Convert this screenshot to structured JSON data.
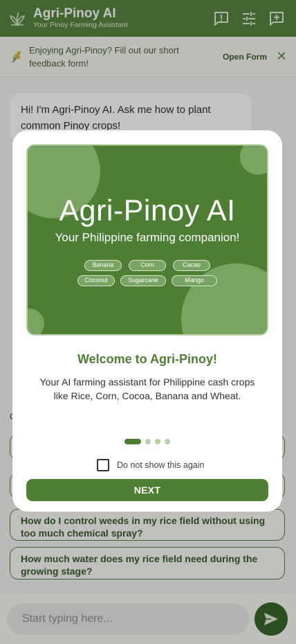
{
  "header": {
    "title": "Agri-Pinoy AI",
    "subtitle": "Your Pinoy Farming Assistant",
    "icons": [
      "feedback-icon",
      "tune-icon",
      "new-chat-icon"
    ]
  },
  "banner": {
    "text": "Enjoying Agri-Pinoy? Fill out our short feedback form!",
    "link": "Open Form",
    "close": "✕"
  },
  "chat": {
    "greeting": "Hi! I'm Agri-Pinoy AI. Ask me how to plant common Pinoy crops!",
    "common_label": "C",
    "suggestions": [
      "",
      "",
      "How do I control weeds in my rice field without using too much chemical spray?",
      "How much water does my rice field need during the growing stage?"
    ]
  },
  "input": {
    "placeholder": "Start typing here..."
  },
  "modal": {
    "hero": {
      "title": "Agri-Pinoy AI",
      "subtitle": "Your Philippine farming companion!",
      "chips_row1": [
        "Banana",
        "Corn",
        "Cacao"
      ],
      "chips_row2": [
        "Coconut",
        "Sugarcane",
        "Mango"
      ]
    },
    "welcome": "Welcome to Agri-Pinoy!",
    "description": "Your AI farming assistant for Philippine cash crops like Rice, Corn, Cocoa, Banana and Wheat.",
    "dots_total": 4,
    "dots_active": 1,
    "dont_show": "Do not show this again",
    "next": "NEXT"
  },
  "colors": {
    "primary": "#4e7d34",
    "dark": "#2f5a1f",
    "light": "#b5d0a3"
  }
}
